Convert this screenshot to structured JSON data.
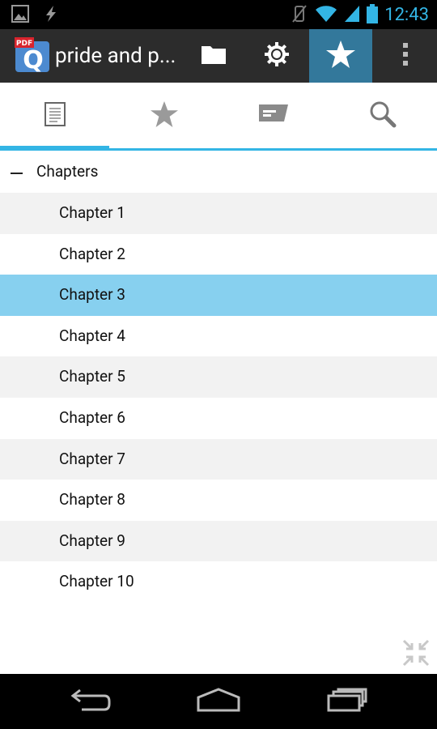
{
  "status_bar": {
    "time": "12:43",
    "icons": [
      "image-icon",
      "lightning-icon",
      "mute-vibrate-icon",
      "wifi-icon",
      "signal-icon",
      "battery-icon"
    ]
  },
  "action_bar": {
    "app_icon_badge": "PDF",
    "app_icon_letter": "Q",
    "title": "pride and p...",
    "buttons": [
      "folder-icon",
      "settings-icon",
      "star-icon",
      "overflow-menu-icon"
    ],
    "active_button": "star-icon"
  },
  "tabs": {
    "items": [
      "document-icon",
      "star-icon",
      "comment-icon",
      "search-icon"
    ],
    "selected_index": 0
  },
  "tree": {
    "header_label": "Chapters",
    "chapters": [
      "Chapter 1",
      "Chapter 2",
      "Chapter 3",
      "Chapter 4",
      "Chapter 5",
      "Chapter 6",
      "Chapter 7",
      "Chapter 8",
      "Chapter 9",
      "Chapter 10"
    ],
    "selected_index": 2
  },
  "colors": {
    "accent": "#33b5e5",
    "action_bar": "#2c2c2c",
    "active_action": "#33789b",
    "selected_row": "#87d0ef",
    "alt_row": "#f2f2f2"
  },
  "nav_bar": {
    "buttons": [
      "back-icon",
      "home-icon",
      "recent-apps-icon"
    ]
  }
}
